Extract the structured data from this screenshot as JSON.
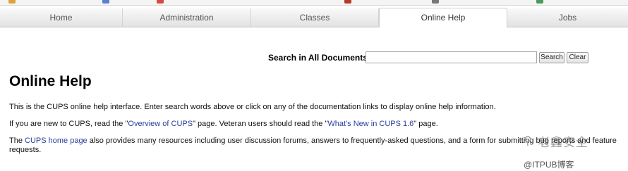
{
  "tabs": [
    {
      "label": "Home",
      "active": false
    },
    {
      "label": "Administration",
      "active": false
    },
    {
      "label": "Classes",
      "active": false
    },
    {
      "label": "Online Help",
      "active": true
    },
    {
      "label": "Jobs",
      "active": false
    }
  ],
  "search": {
    "label": "Search in All Documents:",
    "value": "",
    "search_button": "Search",
    "clear_button": "Clear"
  },
  "page_title": "Online Help",
  "paragraphs": {
    "p1": "This is the CUPS online help interface. Enter search words above or click on any of the documentation links to display online help information.",
    "p2_before": "If you are new to CUPS, read the \"",
    "p2_link1": "Overview of CUPS",
    "p2_middle": "\" page. Veteran users should read the \"",
    "p2_link2": "What's New in CUPS 1.6",
    "p2_after": "\" page.",
    "p3_before": "The ",
    "p3_link": "CUPS home page",
    "p3_after": " also provides many resources including user discussion forums, answers to frequently-asked questions, and a form for submitting bug reports and feature requests."
  },
  "watermark": {
    "line1": "老鑫安全",
    "line2": "@ITPUB博客"
  },
  "colors": {
    "link": "#2b3d9c",
    "tab_bar": "#e8e8e8"
  }
}
